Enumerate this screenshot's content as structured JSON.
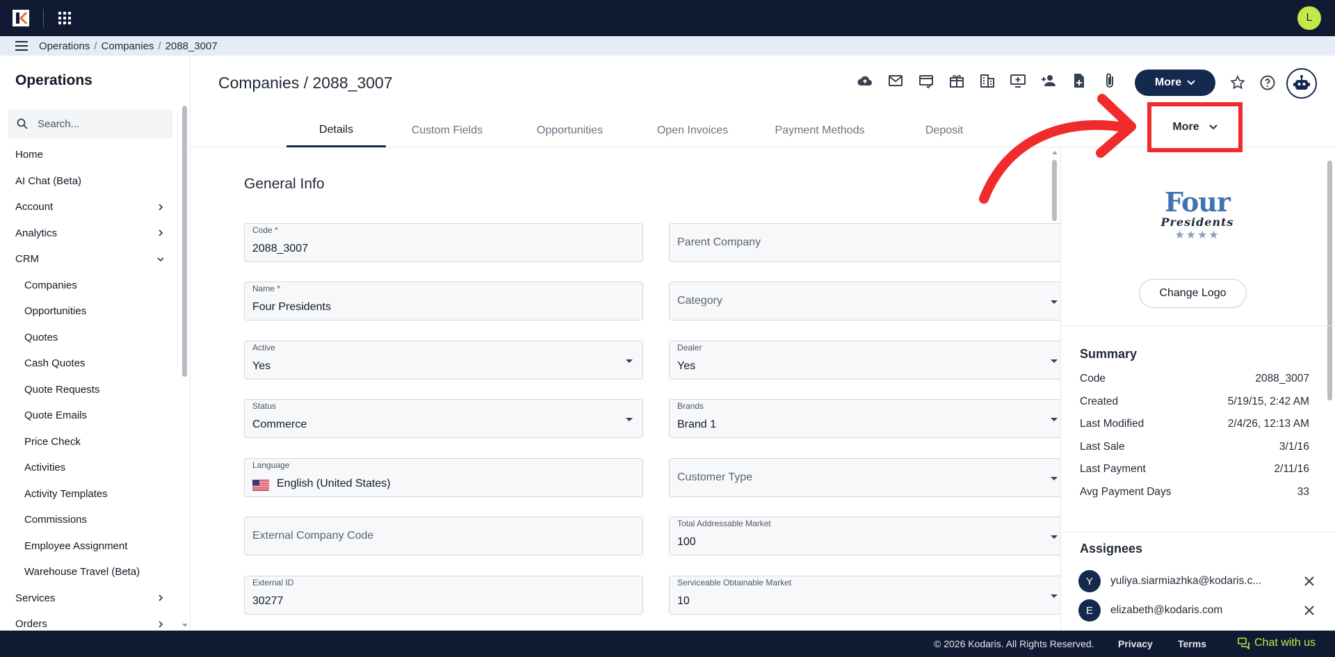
{
  "breadcrumb": [
    "Operations",
    "Companies",
    "2088_3007"
  ],
  "user": {
    "initial": "L"
  },
  "sidebar": {
    "title": "Operations",
    "search_placeholder": "Search...",
    "items": [
      {
        "label": "Home",
        "level": 0,
        "chevron": ""
      },
      {
        "label": "AI Chat (Beta)",
        "level": 0,
        "chevron": ""
      },
      {
        "label": "Account",
        "level": 0,
        "chevron": "right"
      },
      {
        "label": "Analytics",
        "level": 0,
        "chevron": "right"
      },
      {
        "label": "CRM",
        "level": 0,
        "chevron": "down"
      },
      {
        "label": "Companies",
        "level": 1,
        "chevron": ""
      },
      {
        "label": "Opportunities",
        "level": 1,
        "chevron": ""
      },
      {
        "label": "Quotes",
        "level": 1,
        "chevron": ""
      },
      {
        "label": "Cash Quotes",
        "level": 1,
        "chevron": ""
      },
      {
        "label": "Quote Requests",
        "level": 1,
        "chevron": ""
      },
      {
        "label": "Quote Emails",
        "level": 1,
        "chevron": ""
      },
      {
        "label": "Price Check",
        "level": 1,
        "chevron": ""
      },
      {
        "label": "Activities",
        "level": 1,
        "chevron": ""
      },
      {
        "label": "Activity Templates",
        "level": 1,
        "chevron": ""
      },
      {
        "label": "Commissions",
        "level": 1,
        "chevron": ""
      },
      {
        "label": "Employee Assignment",
        "level": 1,
        "chevron": ""
      },
      {
        "label": "Warehouse Travel (Beta)",
        "level": 1,
        "chevron": ""
      },
      {
        "label": "Services",
        "level": 0,
        "chevron": "right"
      },
      {
        "label": "Orders",
        "level": 0,
        "chevron": "right"
      }
    ]
  },
  "header": {
    "title": "Companies / 2088_3007",
    "more_label": "More",
    "toolbar_icons": [
      "cloud-icon",
      "mail-icon",
      "card-check-icon",
      "gift-icon",
      "buildings-icon",
      "monitor-add-icon",
      "person-add-icon",
      "file-add-icon",
      "paperclip-icon"
    ]
  },
  "tabs": [
    "Details",
    "Custom Fields",
    "Opportunities",
    "Open Invoices",
    "Payment Methods",
    "Deposit"
  ],
  "active_tab": "Details",
  "annotation": {
    "label": "More"
  },
  "form": {
    "section_title": "General Info",
    "fields": {
      "code": {
        "label": "Code *",
        "value": "2088_3007"
      },
      "parent_company": {
        "placeholder": "Parent Company"
      },
      "name": {
        "label": "Name *",
        "value": "Four Presidents"
      },
      "category": {
        "placeholder": "Category"
      },
      "active": {
        "label": "Active",
        "value": "Yes"
      },
      "dealer": {
        "label": "Dealer",
        "value": "Yes"
      },
      "status": {
        "label": "Status",
        "value": "Commerce"
      },
      "brands": {
        "label": "Brands",
        "value": "Brand 1"
      },
      "language": {
        "label": "Language",
        "value": "English (United States)"
      },
      "customer_type": {
        "placeholder": "Customer Type"
      },
      "external_company_code": {
        "placeholder": "External Company Code"
      },
      "tam": {
        "label": "Total Addressable Market",
        "value": "100"
      },
      "external_id": {
        "label": "External ID",
        "value": "30277"
      },
      "som": {
        "label": "Serviceable Obtainable Market",
        "value": "10"
      }
    }
  },
  "right_panel": {
    "logo": {
      "line1": "Four",
      "line2": "Presidents",
      "stars": "★★★★"
    },
    "change_logo_label": "Change Logo",
    "summary_title": "Summary",
    "summary": [
      {
        "key": "Code",
        "value": "2088_3007"
      },
      {
        "key": "Created",
        "value": "5/19/15, 2:42 AM"
      },
      {
        "key": "Last Modified",
        "value": "2/4/26, 12:13 AM"
      },
      {
        "key": "Last Sale",
        "value": "3/1/16"
      },
      {
        "key": "Last Payment",
        "value": "2/11/16"
      },
      {
        "key": "Avg Payment Days",
        "value": "33"
      }
    ],
    "assignees_title": "Assignees",
    "assignees": [
      {
        "initial": "Y",
        "email": "yuliya.siarmiazhka@kodaris.c..."
      },
      {
        "initial": "E",
        "email": "elizabeth@kodaris.com"
      }
    ]
  },
  "footer": {
    "copyright": "© 2026 Kodaris. All Rights Reserved.",
    "privacy": "Privacy",
    "terms": "Terms",
    "chat": "Chat with us"
  },
  "colors": {
    "navy": "#111a33",
    "brand_navy": "#14294e",
    "accent_lime": "#c3e84b",
    "annotation_red": "#ef2b2b"
  }
}
